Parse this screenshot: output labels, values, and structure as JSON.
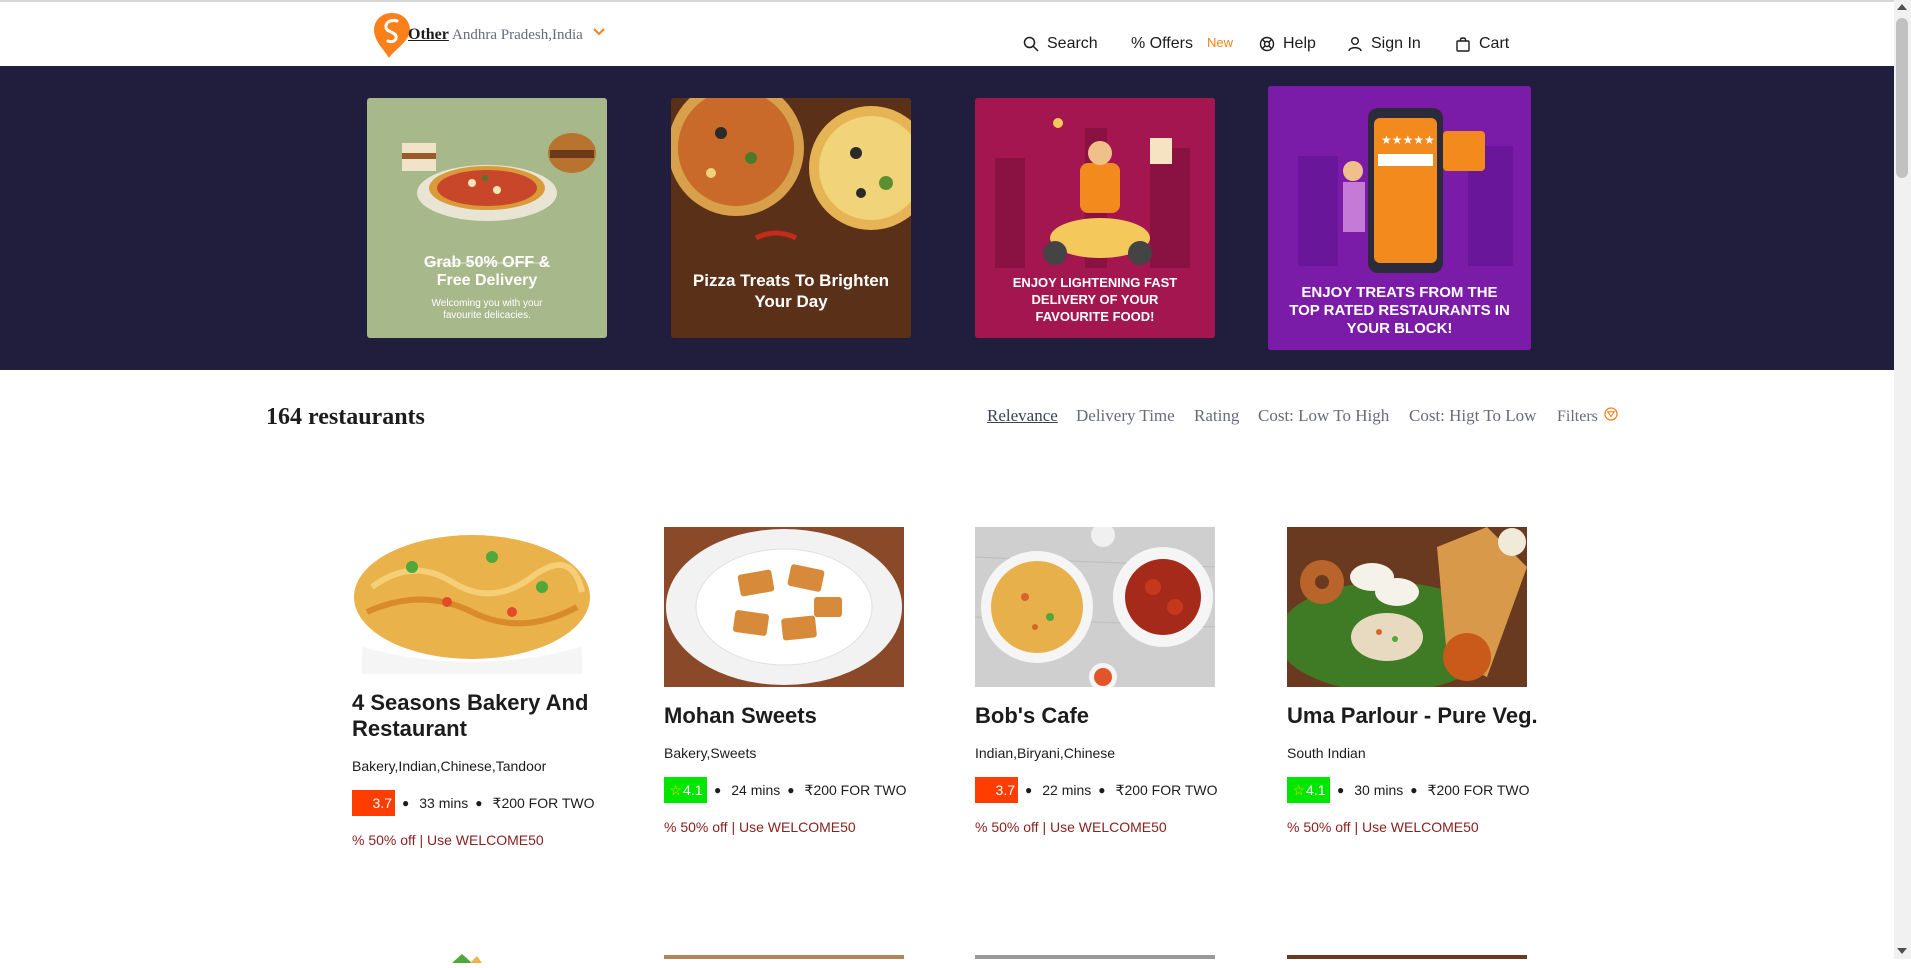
{
  "header": {
    "location_other": "Other",
    "location_text": "Andhra Pradesh,India",
    "nav": {
      "search": "Search",
      "offers": "% Offers",
      "offers_badge": "New",
      "help": "Help",
      "signin": "Sign In",
      "cart": "Cart"
    },
    "brand_color": "#fc8019"
  },
  "banner": {
    "background": "#211d3c",
    "cards": [
      {
        "title": "Grab 50% OFF & Free Delivery",
        "subtitle": "Welcoming you with your favourite delicacies."
      },
      {
        "title": "Pizza Treats To Brighten Your Day"
      },
      {
        "title": "ENJOY LIGHTENING FAST DELIVERY OF YOUR FAVOURITE FOOD!"
      },
      {
        "title": "ENJOY TREATS FROM THE TOP RATED RESTAURANTS IN YOUR BLOCK!"
      }
    ]
  },
  "listing": {
    "count_label": "164 restaurants",
    "sort": {
      "relevance": "Relevance",
      "delivery_time": "Delivery Time",
      "rating": "Rating",
      "cost_low_high": "Cost: Low To High",
      "cost_high_low": "Cost: Higt To Low",
      "filters": "Filters"
    }
  },
  "restaurants": [
    {
      "name": "4 Seasons Bakery And Restaurant",
      "cuisines": "Bakery,Indian,Chinese,Tandoor",
      "rating": "3.7",
      "rating_color": "#ff3d00",
      "time": "33 mins",
      "cost": "₹200 FOR TWO",
      "offer": "% 50% off | Use WELCOME50"
    },
    {
      "name": "Mohan Sweets",
      "cuisines": "Bakery,Sweets",
      "rating": "4.1",
      "rating_color": "#00e600",
      "time": "24 mins",
      "cost": "₹200 FOR TWO",
      "offer": "% 50% off | Use WELCOME50"
    },
    {
      "name": "Bob's Cafe",
      "cuisines": "Indian,Biryani,Chinese",
      "rating": "3.7",
      "rating_color": "#ff3d00",
      "time": "22 mins",
      "cost": "₹200 FOR TWO",
      "offer": "% 50% off | Use WELCOME50"
    },
    {
      "name": "Uma Parlour - Pure Veg.",
      "cuisines": "South Indian",
      "rating": "4.1",
      "rating_color": "#00e600",
      "time": "30 mins",
      "cost": "₹200 FOR TWO",
      "offer": "% 50% off | Use WELCOME50"
    }
  ]
}
